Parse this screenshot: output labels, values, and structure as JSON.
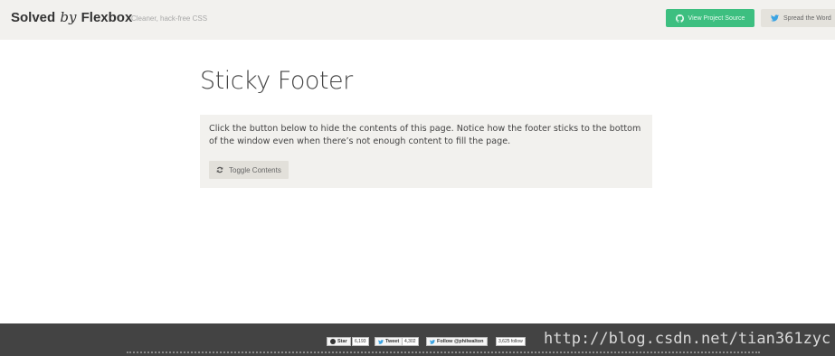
{
  "header": {
    "brand_solved": "Solved",
    "brand_by": "by",
    "brand_flexbox": "Flexbox",
    "tagline": "Cleaner, hack-free CSS",
    "view_source_label": "View Project Source",
    "spread_word_label": "Spread the Word"
  },
  "main": {
    "title": "Sticky Footer",
    "description": "Click the button below to hide the contents of this page. Notice how the footer sticks to the bottom of the window even when there’s not enough content to fill the page.",
    "toggle_label": "Toggle Contents"
  },
  "footer": {
    "star_label": "Star",
    "star_count": "6,193",
    "tweet_label": "Tweet",
    "tweet_count": "4,302",
    "follow_label": "Follow @philwalton",
    "follow_count": "3,625 follow",
    "watermark": "http://blog.csdn.net/tian361zyc"
  },
  "colors": {
    "header_bg": "#f2f1ee",
    "source_button": "#3dbf80",
    "footer_bg": "#434343"
  }
}
